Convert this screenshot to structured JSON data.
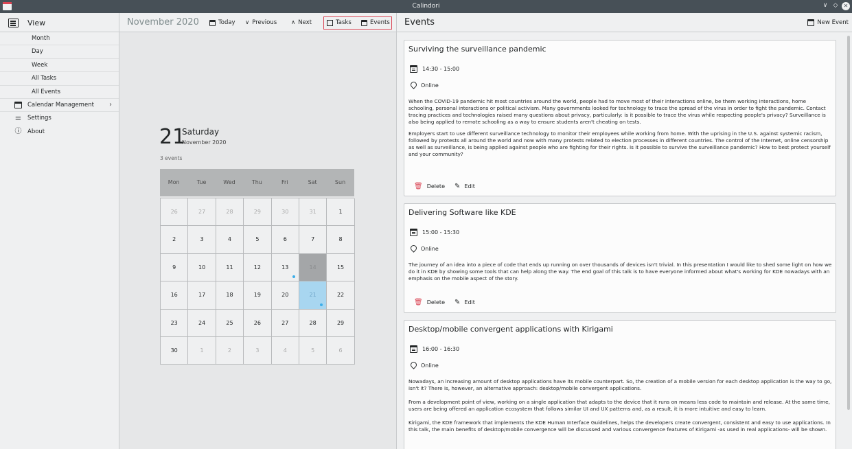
{
  "window": {
    "title": "Calindori",
    "controls": [
      "∨",
      "◇",
      "✕"
    ]
  },
  "sidebar": {
    "header_label": "View",
    "sub_items": [
      "Month",
      "Day",
      "Week",
      "All Tasks",
      "All Events"
    ],
    "calendar_management": "Calendar Management",
    "settings": "Settings",
    "about": "About"
  },
  "toolbar": {
    "month_title": "November 2020",
    "today": "Today",
    "previous": "Previous",
    "next": "Next",
    "tasks": "Tasks",
    "events": "Events"
  },
  "day_view": {
    "day_number": "21",
    "day_name": "Saturday",
    "month_year": "November 2020",
    "events_count": "3 events"
  },
  "calendar": {
    "weekdays": [
      "Mon",
      "Tue",
      "Wed",
      "Thu",
      "Fri",
      "Sat",
      "Sun"
    ],
    "weeks": [
      [
        "26",
        "27",
        "28",
        "29",
        "30",
        "31",
        "1"
      ],
      [
        "2",
        "3",
        "4",
        "5",
        "6",
        "7",
        "8"
      ],
      [
        "9",
        "10",
        "11",
        "12",
        "13",
        "14",
        "15"
      ],
      [
        "16",
        "17",
        "18",
        "19",
        "20",
        "21",
        "22"
      ],
      [
        "23",
        "24",
        "25",
        "26",
        "27",
        "28",
        "29"
      ],
      [
        "30",
        "1",
        "2",
        "3",
        "4",
        "5",
        "6"
      ]
    ],
    "today": "14",
    "selected": "21",
    "event_dots": [
      "13",
      "21"
    ]
  },
  "events_panel": {
    "title": "Events",
    "new_event": "New Event",
    "delete_label": "Delete",
    "edit_label": "Edit",
    "events": [
      {
        "title": "Surviving the surveillance pandemic",
        "time": "14:30 - 15:00",
        "location": "Online",
        "paragraphs": [
          "When the COVID-19 pandemic hit most countries around the world, people had to move most of their interactions online, be them working interactions, home schooling, personal interactions or political activism. Many governments looked for technology to trace the spread of the virus in order to fight the pandemic. Contact tracing practices and technologies raised many questions about privacy, particularly: is it possible to trace the virus while respecting people's privacy? Surveillance is also being applied to remote schooling as a way to ensure students aren't cheating on tests.",
          "Employers start to use different surveillance technology to monitor their employees while working from home. With the uprising in the U.S. against systemic racism, followed by protests all around the world and now with many protests related to election processes in different countries. The control of the Internet, online censorship as well as surveillance, is being applied against people who are fighting for their rights. Is it possible to survive the surveillance pandemic? How to best protect yourself and your community?"
        ]
      },
      {
        "title": "Delivering Software like KDE",
        "time": "15:00 - 15:30",
        "location": "Online",
        "paragraphs": [
          "The journey of an idea into a piece of code that ends up running on over thousands of devices isn't trivial. In this presentation I would like to shed some light on how we do it in KDE by showing some tools that can help along the way. The end goal of this talk is to have everyone informed about what's working for KDE nowadays with an emphasis on the mobile aspect of the story."
        ]
      },
      {
        "title": "Desktop/mobile convergent applications with Kirigami",
        "time": "16:00 - 16:30",
        "location": "Online",
        "paragraphs": [
          "Nowadays, an increasing amount of desktop applications have its mobile counterpart. So, the creation of a mobile version for each desktop application is the way to go, isn't it? There is, however, an alternative approach: desktop/mobile convergent applications.",
          "From a development point of view, working on a single application that adapts to the device that it runs on means less code to maintain and release. At the same time, users are being offered an application ecosystem that follows similar UI and UX patterns and, as a result, it is more intuitive and easy to learn.",
          "Kirigami, the KDE framework that implements the KDE Human Interface Guidelines, helps the developers create convergent, consistent and easy to use applications. In this talk, the main benefits of desktop/mobile convergence will be discussed and various convergence features of Kirigami -as used in real applications- will be shown."
        ]
      }
    ]
  }
}
